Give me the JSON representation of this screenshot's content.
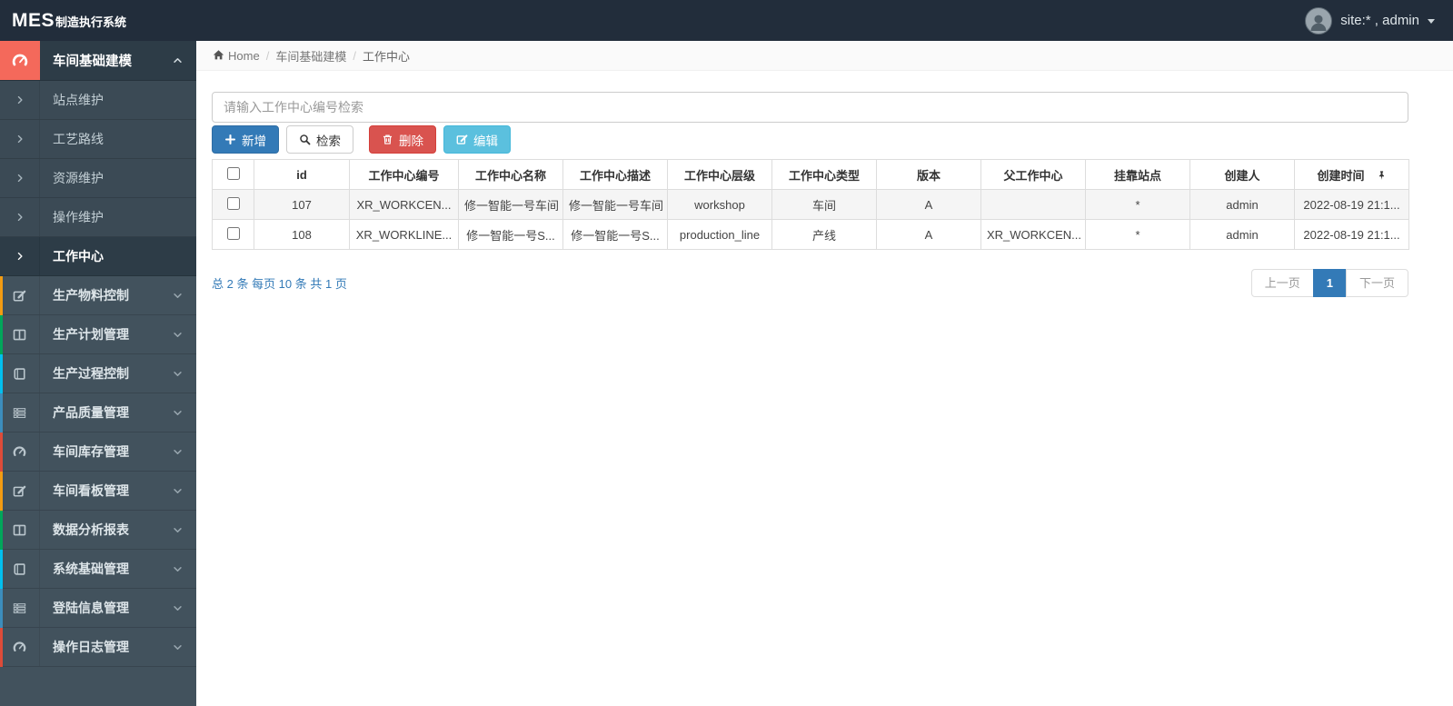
{
  "navbar": {
    "logo_primary": "MES",
    "logo_secondary": "制造执行系统",
    "user_label": "site:* , admin"
  },
  "breadcrumb": {
    "home": "Home",
    "separator": "/",
    "section": "车间基础建模",
    "current": "工作中心"
  },
  "sidebar": {
    "expanded_parent": {
      "label": "车间基础建模"
    },
    "submenu": [
      {
        "label": "站点维护"
      },
      {
        "label": "工艺路线"
      },
      {
        "label": "资源维护"
      },
      {
        "label": "操作维护"
      },
      {
        "label": "工作中心",
        "active": true
      }
    ],
    "groups": [
      {
        "label": "生产物料控制",
        "strip": "#f39c12"
      },
      {
        "label": "生产计划管理",
        "strip": "#00a65a"
      },
      {
        "label": "生产过程控制",
        "strip": "#00c0ef"
      },
      {
        "label": "产品质量管理",
        "strip": "#3c8dbc"
      },
      {
        "label": "车间库存管理",
        "strip": "#dd4b39"
      },
      {
        "label": "车间看板管理",
        "strip": "#f39c12"
      },
      {
        "label": "数据分析报表",
        "strip": "#00a65a"
      },
      {
        "label": "系统基础管理",
        "strip": "#00c0ef"
      },
      {
        "label": "登陆信息管理",
        "strip": "#3c8dbc"
      },
      {
        "label": "操作日志管理",
        "strip": "#dd4b39"
      }
    ]
  },
  "toolbar": {
    "search_placeholder": "请输入工作中心编号检索",
    "add_label": "新增",
    "search_label": "检索",
    "delete_label": "删除",
    "edit_label": "编辑"
  },
  "table": {
    "columns": [
      "id",
      "工作中心编号",
      "工作中心名称",
      "工作中心描述",
      "工作中心层级",
      "工作中心类型",
      "版本",
      "父工作中心",
      "挂靠站点",
      "创建人",
      "创建时间"
    ],
    "rows": [
      {
        "cells": [
          "107",
          "XR_WORKCEN...",
          "修一智能一号车间",
          "修一智能一号车间",
          "workshop",
          "车间",
          "A",
          "",
          "*",
          "admin",
          "2022-08-19 21:1..."
        ]
      },
      {
        "cells": [
          "108",
          "XR_WORKLINE...",
          "修一智能一号S...",
          "修一智能一号S...",
          "production_line",
          "产线",
          "A",
          "XR_WORKCEN...",
          "*",
          "admin",
          "2022-08-19 21:1..."
        ]
      }
    ]
  },
  "pagination": {
    "summary": "总 2 条 每页 10 条 共 1 页",
    "prev_label": "上一页",
    "current_page": "1",
    "next_label": "下一页"
  },
  "colors": {
    "navbar_bg": "#222d3b",
    "sidebar_bg": "#42525d",
    "sidebar_active_bg": "#2d3c47",
    "parent_icon_bg": "#f4695b",
    "primary": "#337ab7",
    "danger": "#d9534f",
    "info": "#5bc0de",
    "pagination_link": "#337ab7"
  }
}
